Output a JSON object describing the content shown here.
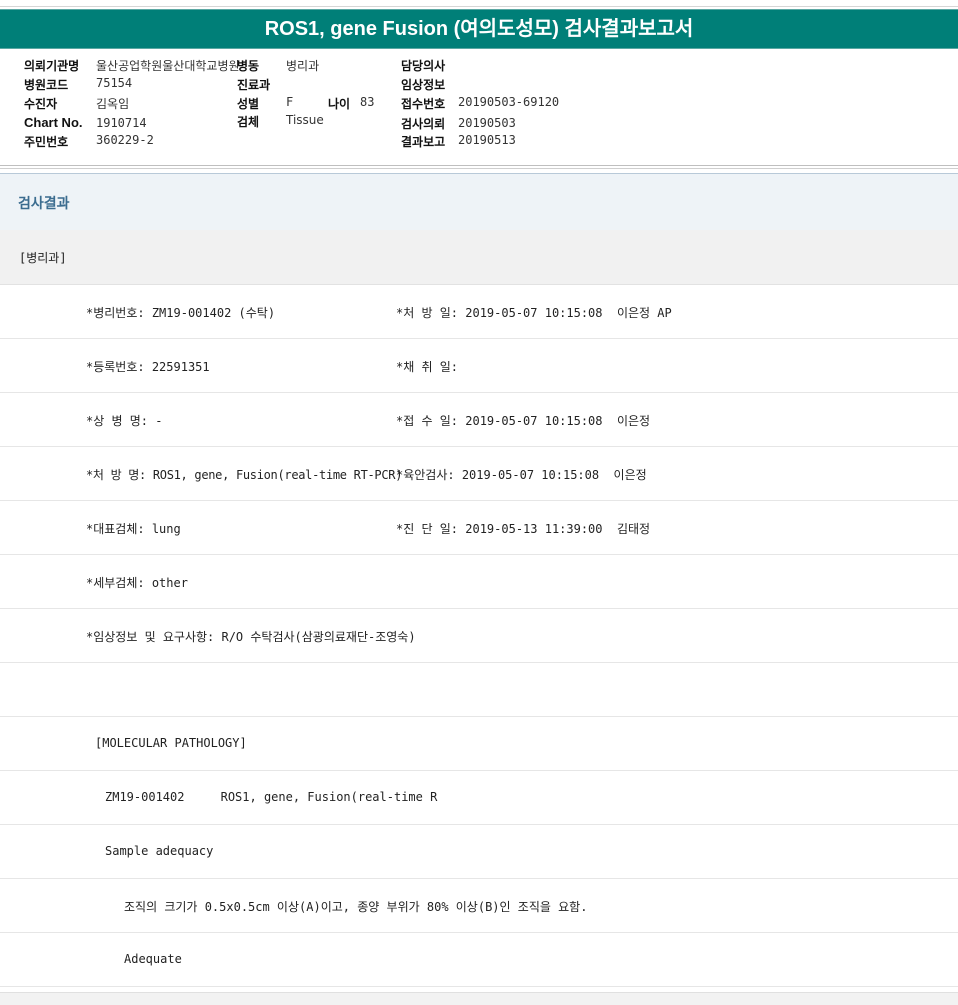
{
  "report_title": "ROS1, gene Fusion (여의도성모) 검사결과보고서",
  "patient_info": {
    "institution_label": "의뢰기관명",
    "institution_value": "울산공업학원울산대학교병원",
    "ward_label": "병동",
    "ward_value": "병리과",
    "doctor_label": "담당의사",
    "doctor_value": "",
    "hospital_code_label": "병원코드",
    "hospital_code_value": "75154",
    "department_label": "진료과",
    "department_value": "",
    "clinical_info_label": "임상정보",
    "clinical_info_value": "",
    "recipient_label": "수진자",
    "recipient_value": "김옥임",
    "sex_label": "성별",
    "sex_value": "F",
    "age_label": "나이",
    "age_value": "83",
    "receipt_no_label": "접수번호",
    "receipt_no_value": "20190503-69120",
    "chart_no_label": "Chart No.",
    "chart_no_value": "1910714",
    "specimen_label": "검체",
    "specimen_value": "Tissue",
    "request_label": "검사의뢰",
    "request_value": "20190503",
    "resident_no_label": "주민번호",
    "resident_no_value": "360229-2",
    "report_label": "결과보고",
    "report_value": "20190513"
  },
  "results": {
    "section_title": "검사결과",
    "subsection_title": "[병리과]",
    "rows": [
      {
        "left": "*병리번호: ZM19-001402 (수탁)",
        "right": "*처 방 일: 2019-05-07 10:15:08  이은정 AP"
      },
      {
        "left": "*등록번호: 22591351",
        "right": "*채 취 일:"
      },
      {
        "left": "*상 병 명: -",
        "right": "*접 수 일: 2019-05-07 10:15:08  이은정"
      },
      {
        "left": "*처 방 명: ROS1, gene, Fusion(real-time RT-PCR)",
        "right": "*육안검사: 2019-05-07 10:15:08  이은정"
      },
      {
        "left": "*대표검체: lung",
        "right": "*진 단 일: 2019-05-13 11:39:00  김태정"
      },
      {
        "left": "*세부검체: other",
        "right": ""
      },
      {
        "left": "*임상정보 및 요구사항: R/O 수탁검사(삼광의료재단-조영숙)",
        "right": ""
      },
      {
        "left": "",
        "right": ""
      }
    ],
    "molecular_header": "[MOLECULAR PATHOLOGY]",
    "test_line": "ZM19-001402     ROS1, gene, Fusion(real-time R",
    "sample_label": "Sample adequacy",
    "criteria_text": "조직의 크기가 0.5x0.5cm 이상(A)이고, 종양 부위가 80% 이상(B)인 조직을 요함.",
    "adequacy_result": "Adequate"
  }
}
